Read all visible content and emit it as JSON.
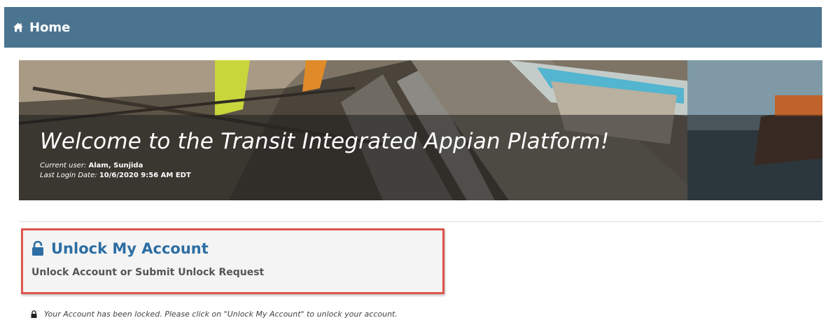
{
  "header": {
    "home_label": "Home",
    "home_icon": "home-icon",
    "bar_color": "#4b7490"
  },
  "banner": {
    "welcome_text": "Welcome to the Transit Integrated Appian Platform!",
    "current_user_label": "Current user:",
    "current_user_value": "Alam, Sunjida",
    "last_login_label": "Last Login Date:",
    "last_login_value": "10/6/2020 9:56 AM EDT"
  },
  "unlock_card": {
    "title": "Unlock My Account",
    "subtitle": "Unlock Account or Submit Unlock Request",
    "icon": "lock-open-icon",
    "highlight_color": "#e0554d",
    "title_color": "#2c6ea3"
  },
  "notice": {
    "icon": "lock-icon",
    "text": "Your Account has been locked. Please click on \"Unlock My Account\" to unlock your account."
  }
}
